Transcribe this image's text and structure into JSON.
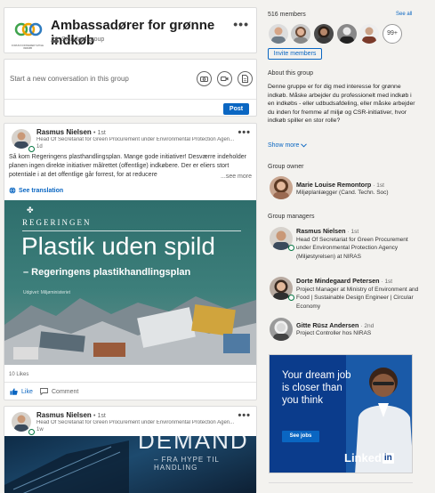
{
  "group": {
    "title": "Ambassadører for grønne indkøb",
    "type_label": "Standard group",
    "logo_text": "FORUM FOR BÆREDYGTIGE INDKØB"
  },
  "composer": {
    "placeholder": "Start a new conversation in this group",
    "post_label": "Post"
  },
  "post1": {
    "author": "Rasmus Nielsen",
    "degree": "• 1st",
    "headline": "Head Of Secretariat for Green Procurement under Environmental Protection Agen...",
    "time": "1d",
    "body": "Så kom Regeringens plasthandlingsplan. Mange gode initiativer! Desværre indeholder planen ingen direkte initiativer målrettet (offentlige) indkøbere. Der er eliers stort potentiale i at det offentlige går forrest, for at reducere",
    "see_more": "...see more",
    "see_translation": "See translation",
    "image": {
      "brand": "REGERINGEN",
      "headline": "Plastik uden spild",
      "subheadline": "– Regeringens plastikhandlingsplan",
      "small_print": "Udgivet: Miljøministeriet"
    },
    "likes": "10 Likes",
    "like_label": "Like",
    "comment_label": "Comment"
  },
  "post2": {
    "author": "Rasmus Nielsen",
    "degree": "• 1st",
    "headline": "Head Of Secretariat for Green Procurement under Environmental Protection Agen...",
    "time": "1w",
    "image": {
      "big_word": "DEMAND",
      "tagline": "– FRA HYPE TIL HANDLING"
    }
  },
  "sidebar": {
    "members_count": "516 members",
    "see_all": "See all",
    "more_badge": "99+",
    "invite_label": "Invite members",
    "about_title": "About this group",
    "about_text": "Denne gruppe er for dig med interesse for grønne indkøb. Måske arbejder du professionelt med indkøb i en indkøbs - eller udbudsafdeling, eller måske arbejder du inden for fremme af miljø og CSR-initiativer, hvor indkøb spiller en stor rolle?",
    "show_more": "Show more",
    "owner_title": "Group owner",
    "owner": {
      "name": "Marie Louise Remontorp",
      "degree": "· 1st",
      "headline": "Miljøplanlægger (Cand. Techn. Soc)"
    },
    "managers_title": "Group managers",
    "managers": [
      {
        "name": "Rasmus Nielsen",
        "degree": "· 1st",
        "headline": "Head Of Secretariat for Green Procurement under Environmental Protection Agency (Miljøstyrelsen) at NIRAS"
      },
      {
        "name": "Dorte Mindegaard Petersen",
        "degree": "· 1st",
        "headline": "Project Manager at Ministry of Environment and Food | Sustainable Design Engineer | Circular Economy"
      },
      {
        "name": "Gitte Rüsz Andersen",
        "degree": "· 2nd",
        "headline": "Project Controller hos NIRAS"
      }
    ]
  },
  "ad": {
    "headline": "Your dream job is closer than you think",
    "cta": "See jobs",
    "brand": "Linked",
    "brand_in": "in"
  },
  "colors": {
    "accent": "#0a66c2",
    "online": "#057642",
    "ad_bg": "#0b3c8c"
  }
}
